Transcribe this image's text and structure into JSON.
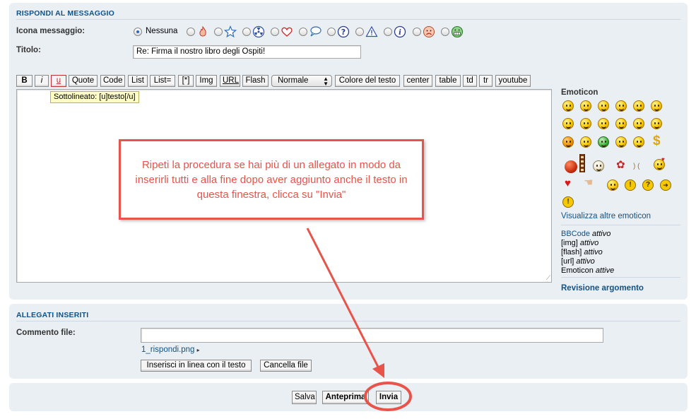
{
  "reply_panel": {
    "title": "RISPONDI AL MESSAGGIO",
    "icon_label": "Icona messaggio:",
    "icon_none": "Nessuna",
    "title_label": "Titolo:",
    "subject_value": "Re: Firma il nostro libro degli Ospiti!"
  },
  "toolbar": {
    "b": "B",
    "i": "i",
    "u": "u",
    "quote": "Quote",
    "code": "Code",
    "list": "List",
    "list_eq": "List=",
    "star": "[*]",
    "img": "Img",
    "url": "URL",
    "flash": "Flash",
    "size_select": "Normale",
    "color": "Colore del testo",
    "center": "center",
    "table": "table",
    "td": "td",
    "tr": "tr",
    "youtube": "youtube",
    "tooltip": "Sottolineato: [u]testo[/u]"
  },
  "emoticons": {
    "title": "Emoticon",
    "more_link": "Visualizza altre emoticon",
    "status": [
      {
        "label": "BBCode",
        "state": "attivo"
      },
      {
        "label": "[img]",
        "state": "attivo"
      },
      {
        "label": "[flash]",
        "state": "attivo"
      },
      {
        "label": "[url]",
        "state": "attivo"
      },
      {
        "label": "Emoticon",
        "state": "attive"
      }
    ],
    "review_link": "Revisione argomento"
  },
  "annotation": {
    "text": "Ripeti la procedura se hai più di un allegato in modo da inserirli tutti e alla fine dopo aver aggiunto anche il testo in questa finestra, clicca su \"Invia\"",
    "color": "#e8534a"
  },
  "attachments": {
    "title": "ALLEGATI INSERITI",
    "comment_label": "Commento file:",
    "comment_value": "",
    "file_name": "1_rispondi.png",
    "insert_button": "Inserisci in linea con il testo",
    "delete_button": "Cancella file"
  },
  "actions": {
    "save": "Salva",
    "preview": "Anteprima",
    "submit": "Invia"
  }
}
